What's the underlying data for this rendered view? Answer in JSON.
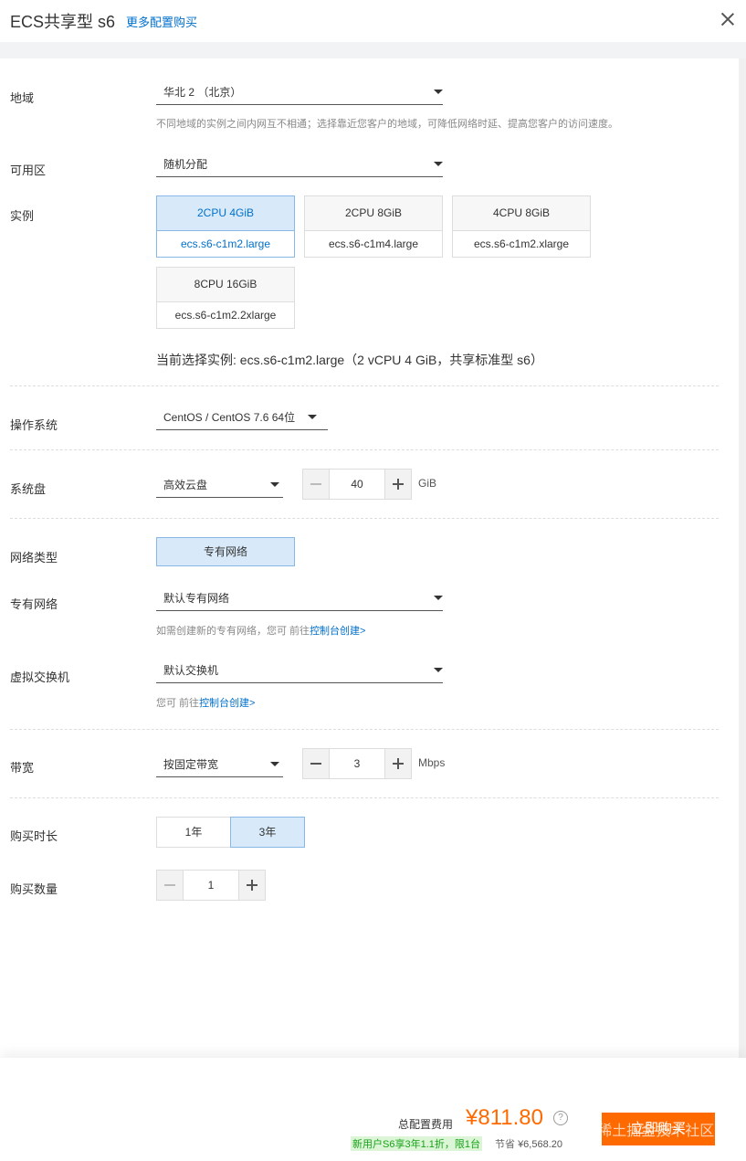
{
  "header": {
    "title": "ECS共享型 s6",
    "more_link": "更多配置购买"
  },
  "region": {
    "label": "地域",
    "value": "华北 2 （北京）",
    "hint": "不同地域的实例之间内网互不相通；选择靠近您客户的地域，可降低网络时延、提高您客户的访问速度。"
  },
  "zone": {
    "label": "可用区",
    "value": "随机分配"
  },
  "instance": {
    "label": "实例",
    "options": [
      {
        "spec": "2CPU 4GiB",
        "model": "ecs.s6-c1m2.large"
      },
      {
        "spec": "2CPU 8GiB",
        "model": "ecs.s6-c1m4.large"
      },
      {
        "spec": "4CPU 8GiB",
        "model": "ecs.s6-c1m2.xlarge"
      },
      {
        "spec": "8CPU 16GiB",
        "model": "ecs.s6-c1m2.2xlarge"
      }
    ],
    "selected_index": 0,
    "current": "当前选择实例: ecs.s6-c1m2.large（2 vCPU 4 GiB，共享标准型 s6）"
  },
  "os": {
    "label": "操作系统",
    "value": "CentOS / CentOS 7.6 64位"
  },
  "disk": {
    "label": "系统盘",
    "type": "高效云盘",
    "size": "40",
    "unit": "GiB"
  },
  "network_type": {
    "label": "网络类型",
    "option": "专有网络"
  },
  "vpc": {
    "label": "专有网络",
    "value": "默认专有网络",
    "hint_prefix": "如需创建新的专有网络，您可 前往",
    "hint_link": "控制台创建>"
  },
  "vswitch": {
    "label": "虚拟交换机",
    "value": "默认交换机",
    "hint_prefix": "您可 前往",
    "hint_link": "控制台创建>"
  },
  "bandwidth": {
    "label": "带宽",
    "type": "按固定带宽",
    "value": "3",
    "unit": "Mbps"
  },
  "duration": {
    "label": "购买时长",
    "options": [
      "1年",
      "3年"
    ],
    "selected_index": 1
  },
  "quantity": {
    "label": "购买数量",
    "value": "1"
  },
  "footer": {
    "total_label": "总配置费用",
    "price": "¥811.80",
    "help_icon": "?",
    "promo": "新用户S6享3年1.1折，限1台",
    "save_label": "节省",
    "save_amount": "¥6,568.20",
    "buy_label": "立即购买",
    "watermark": "@稀土掘金技术社区"
  },
  "colors": {
    "accent": "#0070cc",
    "price": "#ff6a00",
    "buy_bg": "#ff6a00",
    "selected_bg": "#d8eaf9",
    "promo_green": "#19a319"
  }
}
